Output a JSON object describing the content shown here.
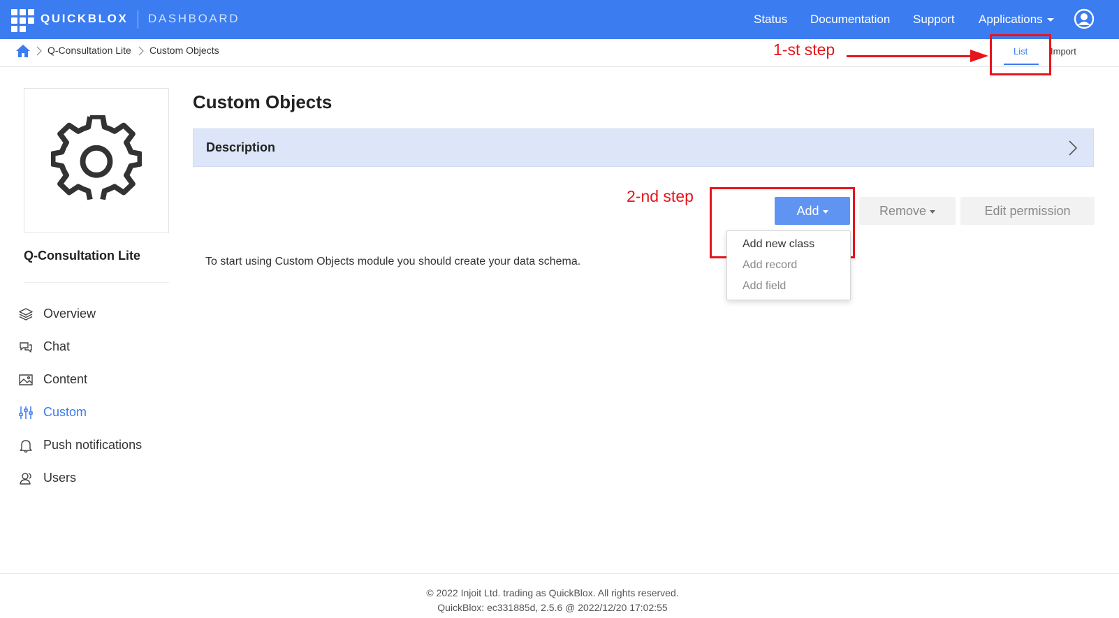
{
  "header": {
    "brand": "QUICKBLOX",
    "brand_sub": "DASHBOARD",
    "nav": {
      "status": "Status",
      "documentation": "Documentation",
      "support": "Support",
      "applications": "Applications"
    },
    "icons": {
      "logo": "grid-logo-icon",
      "account": "user-avatar-icon"
    }
  },
  "breadcrumb": {
    "items": [
      "Q-Consultation Lite",
      "Custom Objects"
    ],
    "icons": {
      "home": "home-icon",
      "separator": "chevron-right-icon"
    }
  },
  "tabs": {
    "list": "List",
    "import": "Import"
  },
  "annotations": {
    "step1": "1-st step",
    "step2": "2-nd step",
    "color": "#e8141b"
  },
  "sidebar": {
    "app_name": "Q-Consultation Lite",
    "app_icon": "gear-icon",
    "items": [
      {
        "label": "Overview",
        "icon": "layers-icon"
      },
      {
        "label": "Chat",
        "icon": "chat-bubbles-icon"
      },
      {
        "label": "Content",
        "icon": "image-icon"
      },
      {
        "label": "Custom",
        "icon": "sliders-icon"
      },
      {
        "label": "Push notifications",
        "icon": "bell-icon"
      },
      {
        "label": "Users",
        "icon": "users-icon"
      }
    ]
  },
  "main": {
    "title": "Custom Objects",
    "description_label": "Description",
    "buttons": {
      "add": "Add",
      "remove": "Remove",
      "edit_permission": "Edit permission"
    },
    "add_menu": {
      "add_new_class": "Add new class",
      "add_record": "Add record",
      "add_field": "Add field"
    },
    "hint": "To start using Custom Objects module you should create your data schema."
  },
  "footer": {
    "copyright": "© 2022 Injoit Ltd. trading as QuickBlox. All rights reserved.",
    "version": "QuickBlox: ec331885d, 2.5.6 @ 2022/12/20 17:02:55"
  },
  "colors": {
    "brand_blue": "#3b7cf0",
    "add_button": "#5f94f2",
    "description_panel": "#dce6f8"
  }
}
